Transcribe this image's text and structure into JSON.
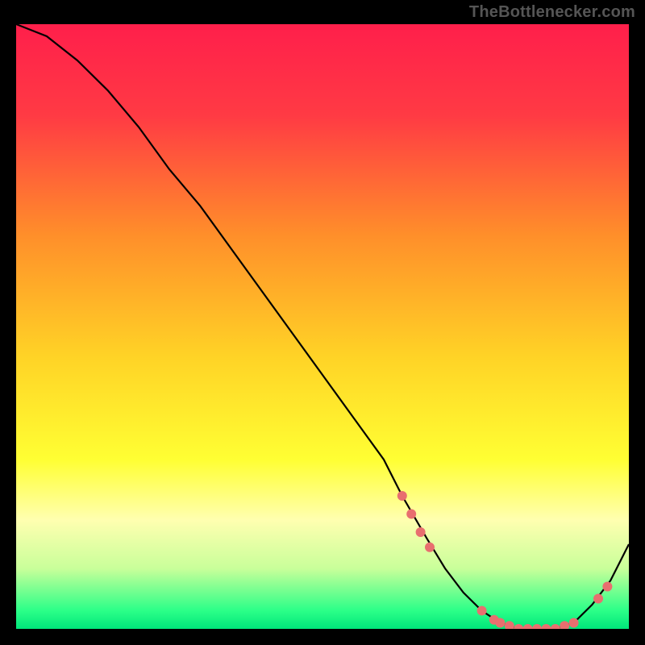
{
  "attribution": "TheBottlenecker.com",
  "chart_data": {
    "type": "line",
    "title": "",
    "xlabel": "",
    "ylabel": "",
    "xlim": [
      0,
      100
    ],
    "ylim": [
      0,
      100
    ],
    "background_gradient": {
      "stops": [
        {
          "offset": 0.0,
          "color": "#ff1f4b"
        },
        {
          "offset": 0.15,
          "color": "#ff3a44"
        },
        {
          "offset": 0.35,
          "color": "#ff8f2a"
        },
        {
          "offset": 0.55,
          "color": "#ffd326"
        },
        {
          "offset": 0.72,
          "color": "#ffff33"
        },
        {
          "offset": 0.82,
          "color": "#ffffb0"
        },
        {
          "offset": 0.9,
          "color": "#c9ff9a"
        },
        {
          "offset": 0.97,
          "color": "#2bff88"
        },
        {
          "offset": 1.0,
          "color": "#00e67a"
        }
      ]
    },
    "series": [
      {
        "name": "bottleneck-curve",
        "color": "#000000",
        "x": [
          0,
          5,
          10,
          15,
          20,
          25,
          30,
          35,
          40,
          45,
          50,
          55,
          60,
          63,
          67,
          70,
          73,
          76,
          79,
          82,
          85,
          88,
          91,
          94,
          97,
          100
        ],
        "y": [
          100,
          98,
          94,
          89,
          83,
          76,
          70,
          63,
          56,
          49,
          42,
          35,
          28,
          22,
          15,
          10,
          6,
          3,
          1,
          0,
          0,
          0,
          1,
          4,
          8,
          14
        ]
      }
    ],
    "markers": {
      "name": "highlight-points",
      "color": "#e86f6f",
      "radius": 6,
      "x": [
        63,
        64.5,
        66,
        67.5,
        76,
        78,
        79,
        80.5,
        82,
        83.5,
        85,
        86.5,
        88,
        89.5,
        91,
        95,
        96.5
      ],
      "y": [
        22,
        19,
        16,
        13.5,
        3,
        1.5,
        1,
        0.5,
        0,
        0,
        0,
        0,
        0,
        0.5,
        1,
        5,
        7
      ]
    }
  }
}
